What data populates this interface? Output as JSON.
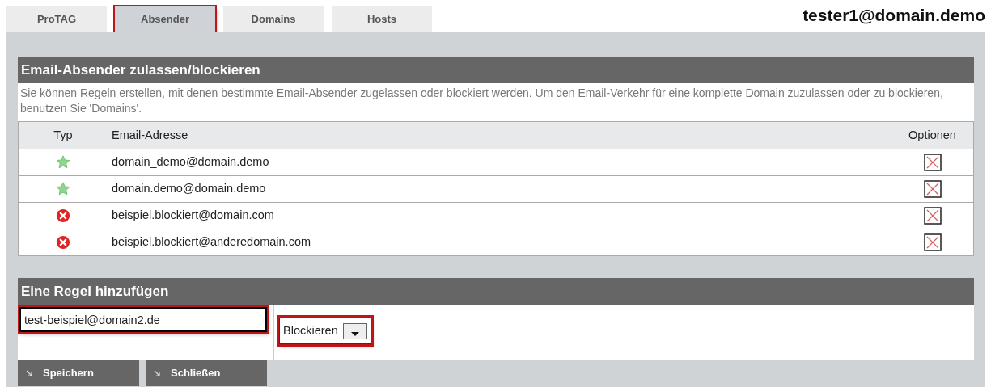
{
  "tabs": [
    {
      "label": "ProTAG",
      "selected": false,
      "highlighted": false
    },
    {
      "label": "Absender",
      "selected": true,
      "highlighted": true
    },
    {
      "label": "Domains",
      "selected": false,
      "highlighted": false
    },
    {
      "label": "Hosts",
      "selected": false,
      "highlighted": false
    }
  ],
  "user": "tester1@domain.demo",
  "section": {
    "title": "Email-Absender zulassen/blockieren",
    "description": "Sie können Regeln erstellen, mit denen bestimmte Email-Absender zugelassen oder blockiert werden. Um den Email-Verkehr für eine komplette Domain zuzulassen oder zu blockieren, benutzen Sie 'Domains'."
  },
  "table": {
    "columns": [
      "Typ",
      "Email-Adresse",
      "Optionen"
    ],
    "rows": [
      {
        "kind": "allowed",
        "email": "domain_demo@domain.demo"
      },
      {
        "kind": "allowed",
        "email": "domain.demo@domain.demo"
      },
      {
        "kind": "blocked",
        "email": "beispiel.blockiert@domain.com"
      },
      {
        "kind": "blocked",
        "email": "beispiel.blockiert@anderedomain.com"
      }
    ]
  },
  "add_rule": {
    "title": "Eine Regel hinzufügen",
    "email_field": {
      "value": "test-beispiel@domain2.de",
      "highlighted": true
    },
    "action_select": {
      "value": "Blockieren",
      "highlighted": true
    }
  },
  "buttons": [
    "Speichern",
    "Schließen"
  ]
}
